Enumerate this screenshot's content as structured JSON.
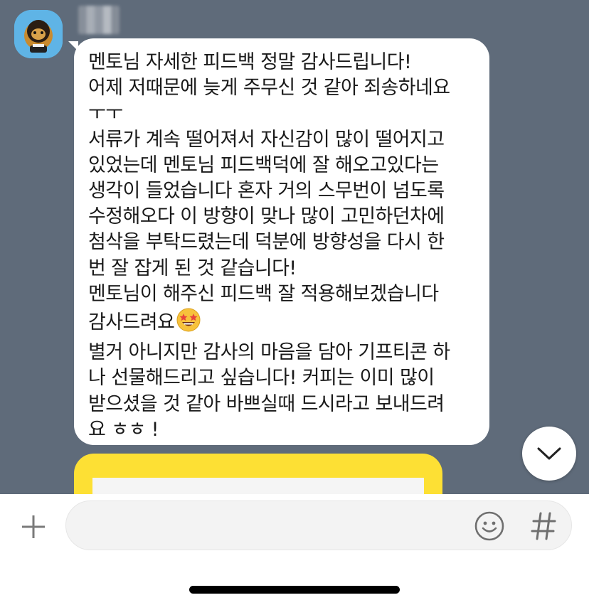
{
  "colors": {
    "chat_background": "#5f6b7a",
    "bubble_background": "#ffffff",
    "gift_card_yellow": "#fde034",
    "avatar_background": "#5fb4e6"
  },
  "sender": {
    "name_blurred": true,
    "avatar_icon": "character-avatar-icon"
  },
  "message": {
    "lines": [
      "멘토님 자세한 피드백 정말 감사드립니다!",
      "어제 저때문에 늦게 주무신 것 같아 죄송하네요",
      "ㅜㅜ",
      "서류가 계속 떨어져서 자신감이 많이 떨어지고",
      "있었는데 멘토님 피드백덕에 잘 해오고있다는",
      "생각이 들었습니다 혼자 거의 스무번이 넘도록",
      "수정해오다 이 방향이 맞나 많이 고민하던차에",
      "첨삭을 부탁드렸는데 덕분에 방향성을 다시 한",
      "번 잘 잡게 된 것 같습니다!",
      "멘토님이 해주신 피드백 잘 적용해보겠습니다",
      "감사드려요",
      "별거 아니지만 감사의 마음을 담아 기프티콘 하",
      "나 선물해드리고 싶습니다! 커피는 이미 많이",
      "받으셨을 것 같아 바쁘실때 드시라고 보내드려",
      "요 ㅎㅎ !"
    ],
    "emoji_after_line_11": "star-struck-emoji-icon"
  },
  "input": {
    "value": "",
    "placeholder": ""
  },
  "icons": {
    "plus": "plus-icon",
    "emoticon": "smiley-icon",
    "hash": "hash-icon",
    "scroll_down": "chevron-down-icon"
  },
  "labels": {
    "hash_glyph": "#"
  }
}
